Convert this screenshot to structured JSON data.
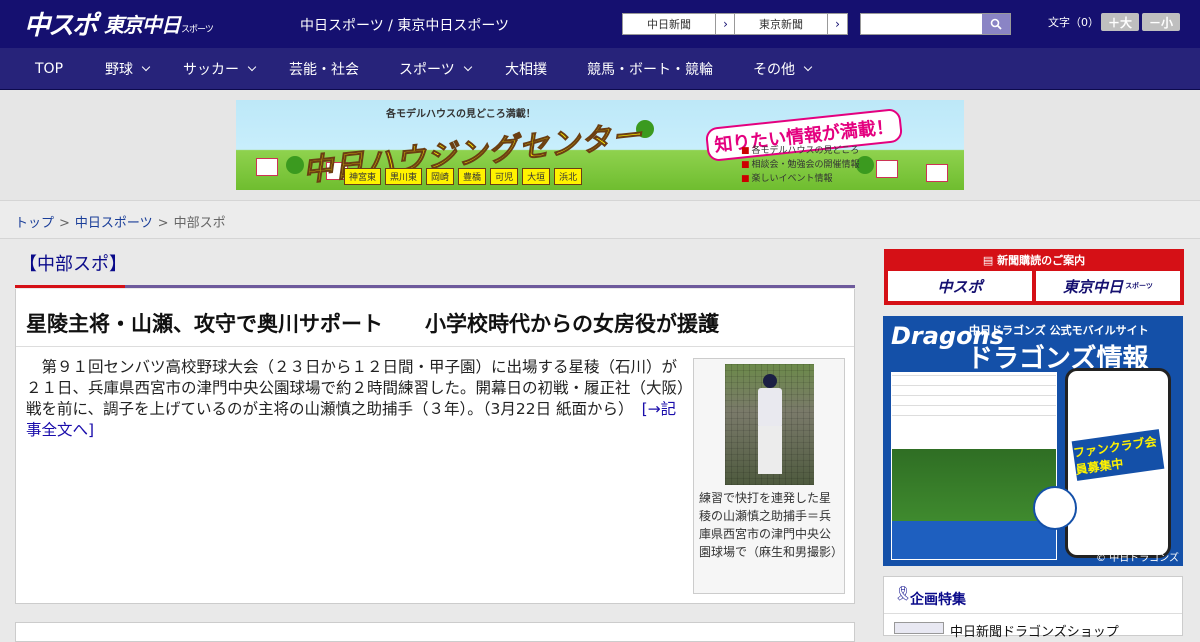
{
  "header": {
    "logo_main": "中スポ",
    "logo_sub": "東京中日",
    "logo_sub_small": "スポーツ",
    "tagline": "中日スポーツ / 東京中日スポーツ",
    "ext_links": [
      {
        "label": "中日新聞",
        "arrow": "›"
      },
      {
        "label": "東京新聞",
        "arrow": "›"
      }
    ],
    "search_placeholder": "",
    "font_size_label": "文字（0）",
    "size_up_label": "＋大",
    "size_down_label": "－小"
  },
  "nav": {
    "items": [
      {
        "label": "TOP"
      },
      {
        "label": "野球"
      },
      {
        "label": "サッカー"
      },
      {
        "label": "芸能・社会"
      },
      {
        "label": "スポーツ"
      },
      {
        "label": "大相撲"
      },
      {
        "label": "競馬・ボート・競輪"
      },
      {
        "label": "その他"
      }
    ]
  },
  "ad": {
    "top_text": "各モデルハウスの見どころ満載！",
    "title": "中日ハウジングセンター",
    "right_text": "知りたい情報が満載！",
    "bullets": [
      "各モデルハウスの見どころ",
      "相談会・勉強会の開催情報",
      "楽しいイベント情報"
    ],
    "cities": [
      "神宮東",
      "黒川東",
      "岡崎",
      "豊橋",
      "可児",
      "大垣",
      "浜北"
    ]
  },
  "breadcrumb": {
    "items": [
      {
        "label": "トップ"
      },
      {
        "label": "中日スポーツ"
      },
      {
        "label": "中部スポ"
      }
    ],
    "separator": ">"
  },
  "section": {
    "title": "【中部スポ】"
  },
  "article": {
    "title": "星陵主将・山瀬、攻守で奥川サポート　　小学校時代からの女房役が援護",
    "body": "　第９１回センバツ高校野球大会（２３日から１２日間・甲子園）に出場する星稜（石川）が２１日、兵庫県西宮市の津門中央公園球場で約２時間練習した。開幕日の初戦・履正社（大阪）戦を前に、調子を上げているのが主将の山瀬慎之助捕手（３年）。（3月22日 紙面から）",
    "more_link": "[→記事全文へ]",
    "photo_caption": "練習で快打を連発した星稜の山瀬慎之助捕手＝兵庫県西宮市の津門中央公園球場で（麻生和男撮影）"
  },
  "sidebar": {
    "subscribe_title": "新聞購読のご案内",
    "subscribe_buttons": [
      {
        "label": "中スポ",
        "small": ""
      },
      {
        "label": "東京中日",
        "small": "スポーツ"
      }
    ],
    "dragons": {
      "logo": "Dragons",
      "sub": "中日ドラゴンズ 公式モバイルサイト",
      "title": "ドラゴンズ情報",
      "phone_banner": "ファンクラブ会員募集中",
      "footer": "© 中日ドラゴンズ"
    },
    "kikaku_title": "企画特集",
    "kikaku_item": "中日新聞ドラゴンズショップ"
  },
  "colors": {
    "header_bg": "#151070",
    "nav_bg": "#27237a",
    "accent_red": "#d51016",
    "section_line": "#6e5a9c"
  },
  "icons": {
    "search": "search-icon",
    "chevron": "chevron-down-icon",
    "ribbon": "ribbon-icon"
  }
}
